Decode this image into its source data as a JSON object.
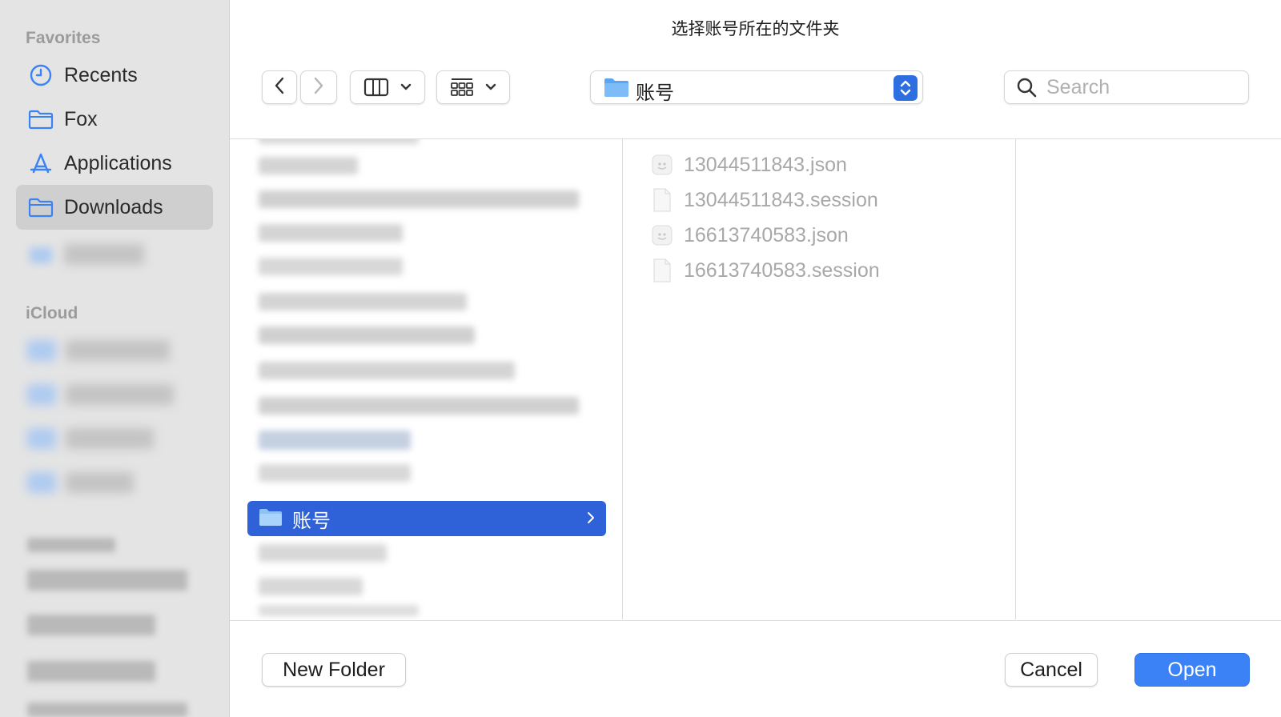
{
  "dialog": {
    "title": "选择账号所在的文件夹"
  },
  "sidebar": {
    "favorites_title": "Favorites",
    "icloud_title": "iCloud",
    "favorites": [
      {
        "label": "Recents",
        "icon": "clock-icon"
      },
      {
        "label": "Fox",
        "icon": "folder-icon"
      },
      {
        "label": "Applications",
        "icon": "applications-icon"
      },
      {
        "label": "Downloads",
        "icon": "folder-icon",
        "selected": true
      }
    ]
  },
  "toolbar": {
    "back_icon": "chevron-left-icon",
    "forward_icon": "chevron-right-icon",
    "view_mode_icon": "columns-view-icon",
    "group_icon": "grid-view-icon",
    "path_label": "账号",
    "search_placeholder": "Search"
  },
  "columns": {
    "col1_selected": {
      "label": "账号",
      "icon": "folder-icon"
    },
    "col2_files": [
      {
        "name": "13044511843.json",
        "icon": "json-file-icon"
      },
      {
        "name": "13044511843.session",
        "icon": "document-icon"
      },
      {
        "name": "16613740583.json",
        "icon": "json-file-icon"
      },
      {
        "name": "16613740583.session",
        "icon": "document-icon"
      }
    ]
  },
  "buttons": {
    "new_folder": "New Folder",
    "cancel": "Cancel",
    "open": "Open"
  },
  "colors": {
    "accent": "#3a82f6",
    "selection": "#2f61d8",
    "sidebar_bg": "#e4e4e4",
    "folder_icon": "#3b82f6"
  }
}
